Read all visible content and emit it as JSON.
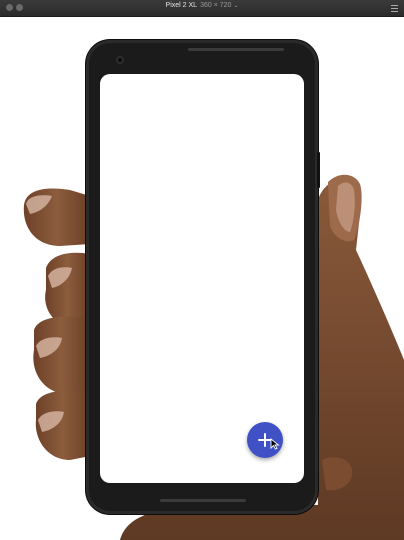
{
  "window": {
    "device_name": "Pixel 2 XL",
    "device_size": "360 × 720",
    "dropdown_glyph": "⌄"
  },
  "fab": {
    "icon": "add-icon",
    "color": "#3f51c5"
  },
  "colors": {
    "skin": "#8a5a3c",
    "skin_dark": "#5a3620",
    "phone_body": "#1b1b1b"
  }
}
